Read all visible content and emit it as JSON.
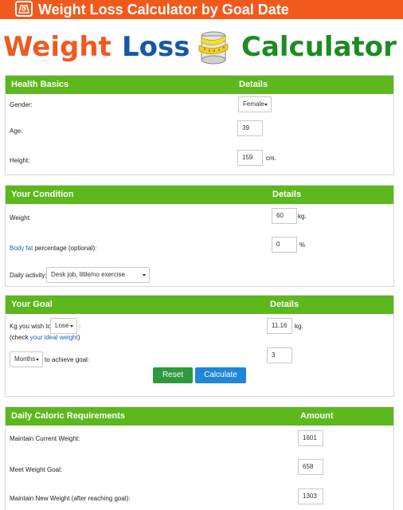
{
  "header": {
    "title": "Weight Loss Calculator by Goal Date",
    "logo_word1": "Weight",
    "logo_word2": "Loss",
    "logo_word3": "Calculator"
  },
  "health": {
    "title": "Health Basics",
    "col": "Details",
    "gender_label": "Gender:",
    "gender_value": "Female",
    "age_label": "Age:",
    "age_value": "39",
    "height_label": "Height:",
    "height_value": "159",
    "height_unit": "cm."
  },
  "condition": {
    "title": "Your Condition",
    "col": "Details",
    "weight_label": "Weight:",
    "weight_value": "60",
    "weight_unit": "kg.",
    "bodyfat_link": "Body fat",
    "bodyfat_label": " percentage (optional):",
    "bodyfat_value": "0",
    "bodyfat_unit": "%",
    "activity_label": "Daily activity:",
    "activity_value": "Desk job, little/no exercise"
  },
  "goal": {
    "title": "Your Goal",
    "col": "Details",
    "kg_label": "Kg you wish to",
    "kg_mode": "Lose",
    "kg_punct": ":",
    "check_pre": "(check ",
    "check_link": "your ideal weight",
    "check_post": ")",
    "kg_value": "11.16",
    "kg_unit": "kg.",
    "period_unit": "Months",
    "period_label": "to achieve goal:",
    "period_value": "3",
    "reset_label": "Reset",
    "calc_label": "Calculate"
  },
  "results": {
    "title": "Daily Caloric Requirements",
    "col": "Amount",
    "rows": [
      {
        "label": "Maintain Current Weight:",
        "value": "1601"
      },
      {
        "label": "Meet Weight Goal:",
        "value": "658"
      },
      {
        "label": "Maintain New Weight (after reaching goal):",
        "value": "1303"
      }
    ]
  },
  "colors": {
    "header_bg": "#f25a1d",
    "panel_head": "#5cb81d",
    "reset_btn": "#2e9a3e",
    "calc_btn": "#1f86d8"
  },
  "icons": [
    "scale-icon",
    "measuring-tape-scale-icon"
  ]
}
